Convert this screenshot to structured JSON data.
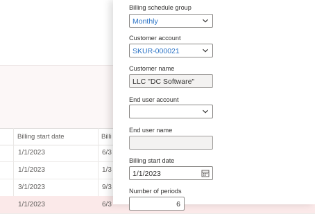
{
  "list": {
    "columns": [
      "Billing start date",
      "Billi"
    ],
    "rows": [
      {
        "start": "1/1/2023",
        "end": "6/3"
      },
      {
        "start": "1/1/2023",
        "end": "1/3"
      },
      {
        "start": "3/1/2023",
        "end": "9/3"
      },
      {
        "start": "1/1/2023",
        "end": "6/3"
      }
    ]
  },
  "form": {
    "billing_schedule_group": {
      "label": "Billing schedule group",
      "value": "Monthly"
    },
    "customer_account": {
      "label": "Customer account",
      "value": "SKUR-000021"
    },
    "customer_name": {
      "label": "Customer name",
      "value": "LLC \"DC Software\""
    },
    "end_user_account": {
      "label": "End user account",
      "value": ""
    },
    "end_user_name": {
      "label": "End user name",
      "value": ""
    },
    "billing_start_date": {
      "label": "Billing start date",
      "value": "1/1/2023"
    },
    "number_of_periods": {
      "label": "Number of periods",
      "value": "6"
    }
  },
  "icons": {
    "dropdown": "chevron-down-icon",
    "date_picker": "calendar-icon"
  },
  "colors": {
    "link_value": "#2b73c6",
    "selected_row": "#fbe9e9",
    "readonly_field": "#f3f2f1"
  }
}
